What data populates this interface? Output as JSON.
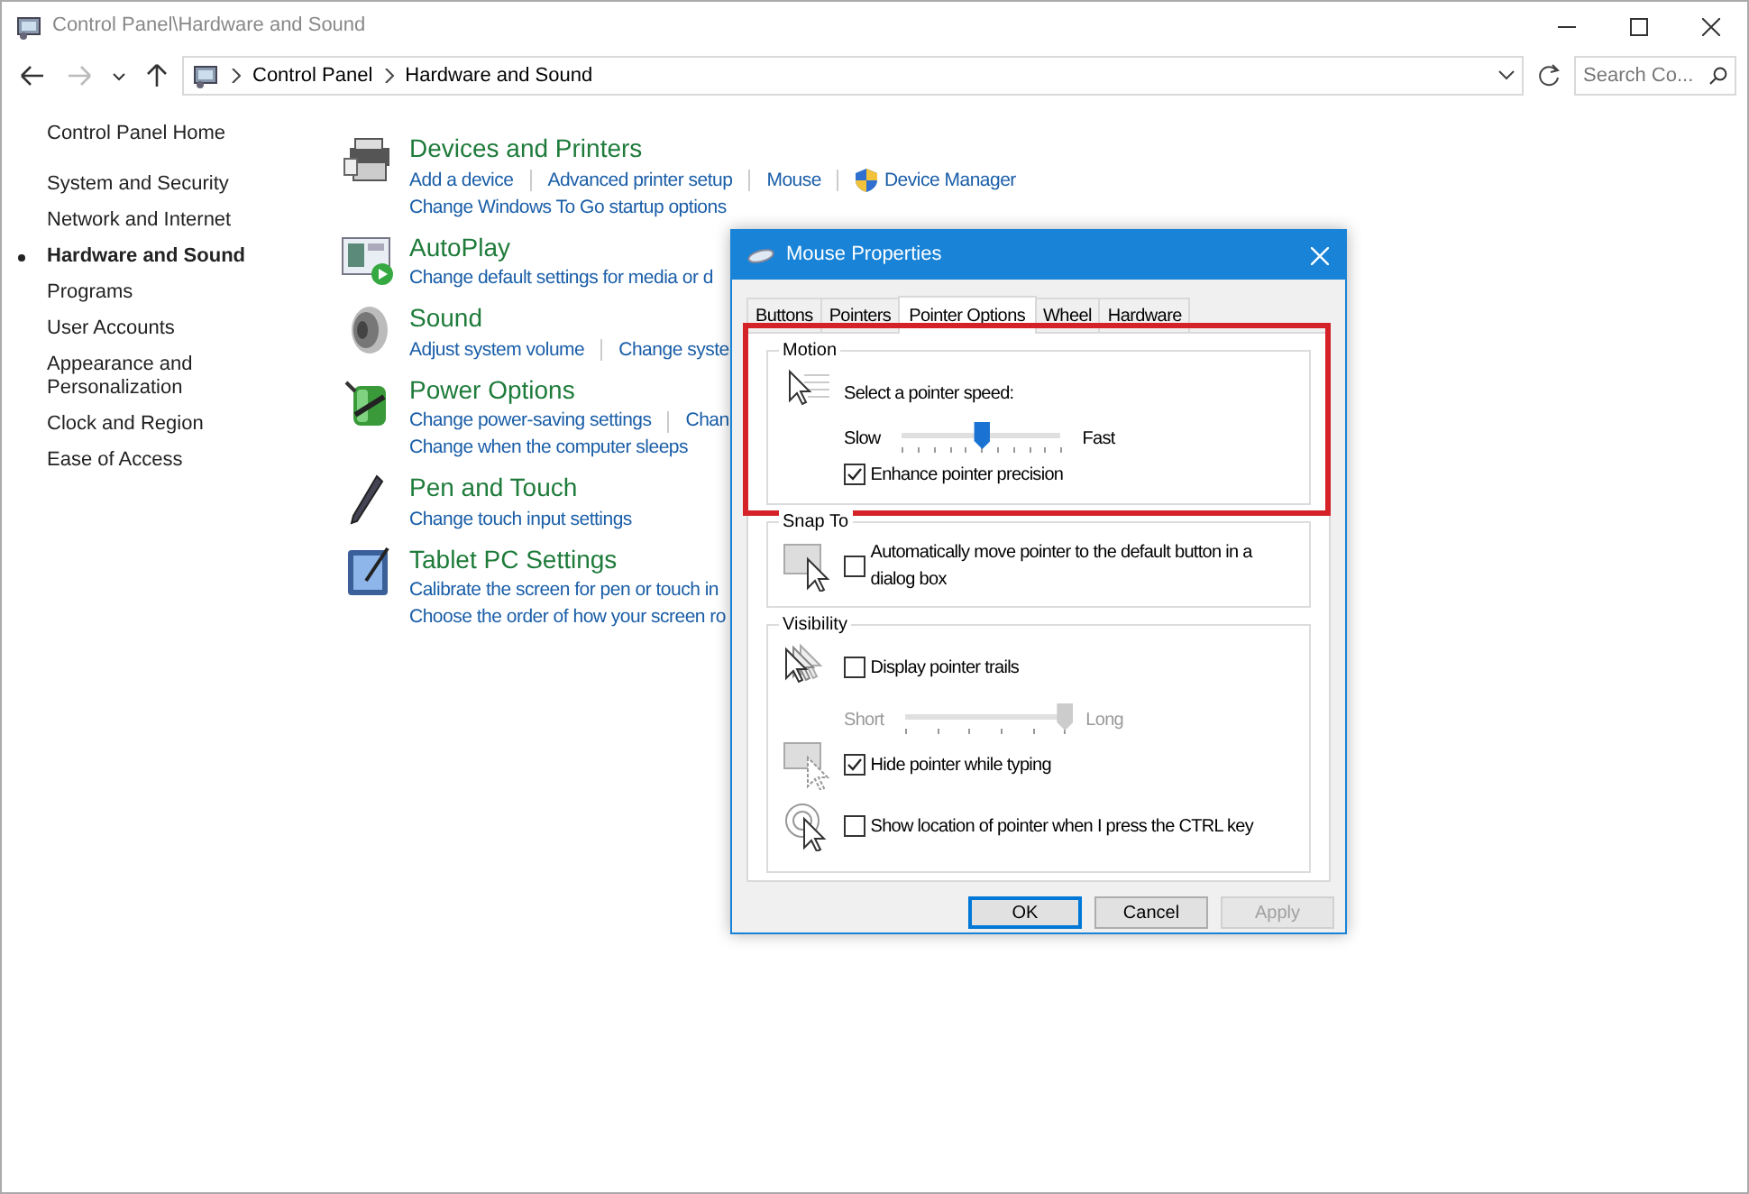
{
  "window": {
    "title": "Control Panel\\Hardware and Sound"
  },
  "address_bar": {
    "breadcrumbs": [
      "Control Panel",
      "Hardware and Sound"
    ],
    "search": {
      "placeholder": "Search Co..."
    }
  },
  "sidebar": {
    "items": [
      {
        "label": "Control Panel Home",
        "selected": false
      },
      {
        "label": "System and Security",
        "selected": false
      },
      {
        "label": "Network and Internet",
        "selected": false
      },
      {
        "label": "Hardware and Sound",
        "selected": true
      },
      {
        "label": "Programs",
        "selected": false
      },
      {
        "label": "User Accounts",
        "selected": false
      },
      {
        "label": "Appearance and Personalization",
        "selected": false
      },
      {
        "label": "Clock and Region",
        "selected": false
      },
      {
        "label": "Ease of Access",
        "selected": false
      }
    ]
  },
  "categories": [
    {
      "title": "Devices and Printers",
      "lines": [
        [
          {
            "text": "Add a device"
          },
          {
            "text": "Advanced printer setup"
          },
          {
            "text": "Mouse"
          },
          {
            "text": "Device Manager"
          }
        ],
        [
          {
            "text": "Change Windows To Go startup options"
          }
        ]
      ]
    },
    {
      "title": "AutoPlay",
      "lines": [
        [
          {
            "text": "Change default settings for media or d"
          }
        ]
      ]
    },
    {
      "title": "Sound",
      "lines": [
        [
          {
            "text": "Adjust system volume"
          },
          {
            "text": "Change syste"
          }
        ]
      ]
    },
    {
      "title": "Power Options",
      "lines": [
        [
          {
            "text": "Change power-saving settings"
          },
          {
            "text": "Chan"
          }
        ],
        [
          {
            "text": "Change when the computer sleeps"
          }
        ]
      ]
    },
    {
      "title": "Pen and Touch",
      "lines": [
        [
          {
            "text": "Change touch input settings"
          }
        ]
      ]
    },
    {
      "title": "Tablet PC Settings",
      "lines": [
        [
          {
            "text": "Calibrate the screen for pen or touch in"
          }
        ],
        [
          {
            "text": "Choose the order of how your screen ro"
          }
        ]
      ]
    }
  ],
  "dialog": {
    "title": "Mouse Properties",
    "tabs": [
      {
        "label": "Buttons",
        "selected": false
      },
      {
        "label": "Pointers",
        "selected": false
      },
      {
        "label": "Pointer Options",
        "selected": true
      },
      {
        "label": "Wheel",
        "selected": false
      },
      {
        "label": "Hardware",
        "selected": false
      }
    ],
    "groups": [
      {
        "title": "Motion",
        "highlighted": true,
        "rows": [
          {
            "kind": "label",
            "text": "Select a pointer speed:"
          },
          {
            "kind": "slider",
            "min_label": "Slow",
            "max_label": "Fast",
            "level": 0.5,
            "disabled": false
          },
          {
            "kind": "checkbox",
            "text": "Enhance pointer precision",
            "checked": true
          }
        ]
      },
      {
        "title": "Snap To",
        "highlighted": false,
        "rows": [
          {
            "kind": "checkbox",
            "text": "Automatically move pointer to the default button in a dialog box",
            "checked": false
          }
        ]
      },
      {
        "title": "Visibility",
        "highlighted": false,
        "rows": [
          {
            "kind": "checkbox",
            "text": "Display pointer trails",
            "checked": false
          },
          {
            "kind": "slider",
            "min_label": "Short",
            "max_label": "Long",
            "level": 1,
            "disabled": true
          },
          {
            "kind": "checkbox",
            "text": "Hide pointer while typing",
            "checked": true
          },
          {
            "kind": "checkbox",
            "text": "Show location of pointer when I press the CTRL key",
            "checked": false
          }
        ]
      }
    ],
    "buttons": [
      {
        "label": "OK",
        "default": true,
        "disabled": false
      },
      {
        "label": "Cancel",
        "default": false,
        "disabled": false
      },
      {
        "label": "Apply",
        "default": false,
        "disabled": true
      }
    ]
  }
}
